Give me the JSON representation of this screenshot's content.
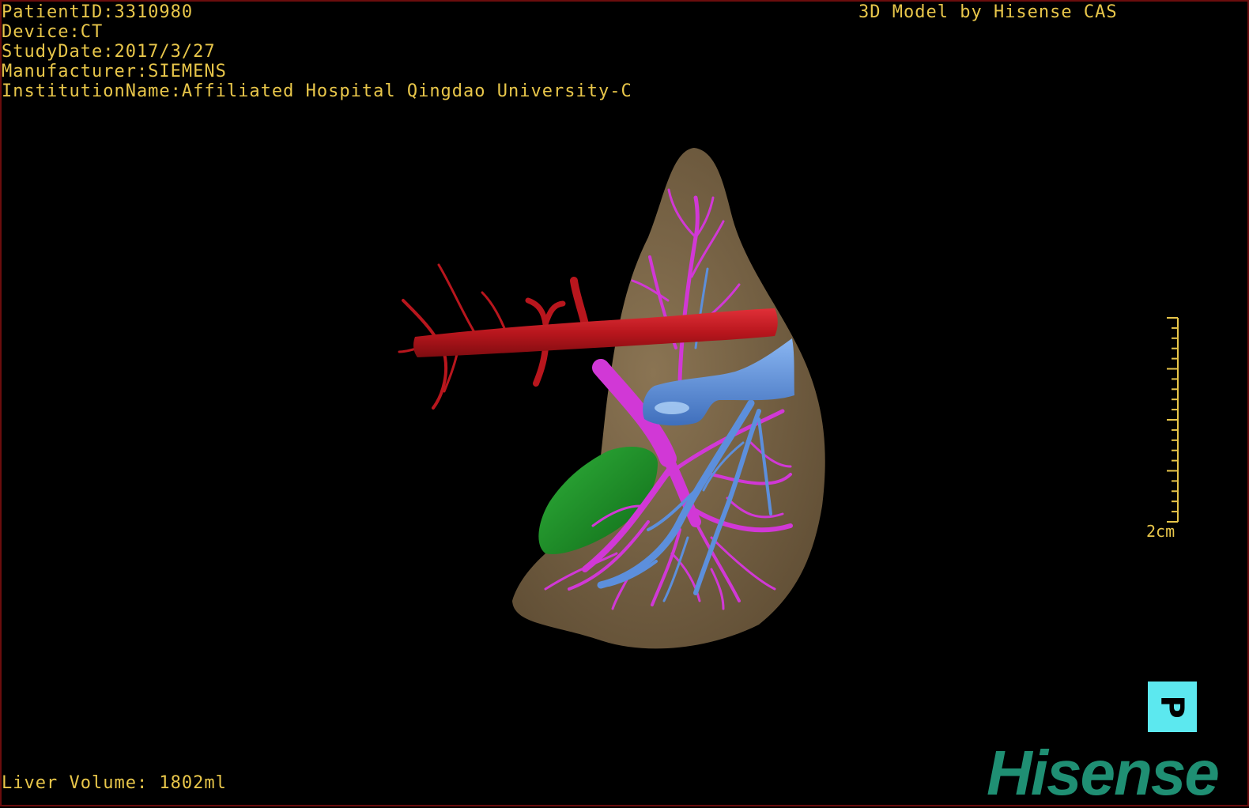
{
  "overlay": {
    "patient_id": "PatientID:3310980",
    "device": "Device:CT",
    "study_date": "StudyDate:2017/3/27",
    "manufacturer": "Manufacturer:SIEMENS",
    "institution": "InstitutionName:Affiliated Hospital Qingdao University-C",
    "credit": "3D Model by Hisense CAS",
    "liver_volume": "Liver Volume: 1802ml"
  },
  "scale_bar": {
    "label": "2cm"
  },
  "orientation": {
    "label": "P"
  },
  "brand": {
    "logo_text": "Hisense"
  },
  "colors": {
    "overlay_text": "#e8c64a",
    "liver": "#7a6647",
    "artery": "#b8161d",
    "portal_vein": "#d138d6",
    "hepatic_vein": "#5c8fdc",
    "gallbladder": "#1b8f26",
    "orientation_cube": "#5ce8ef",
    "brand": "#1f8f73"
  }
}
